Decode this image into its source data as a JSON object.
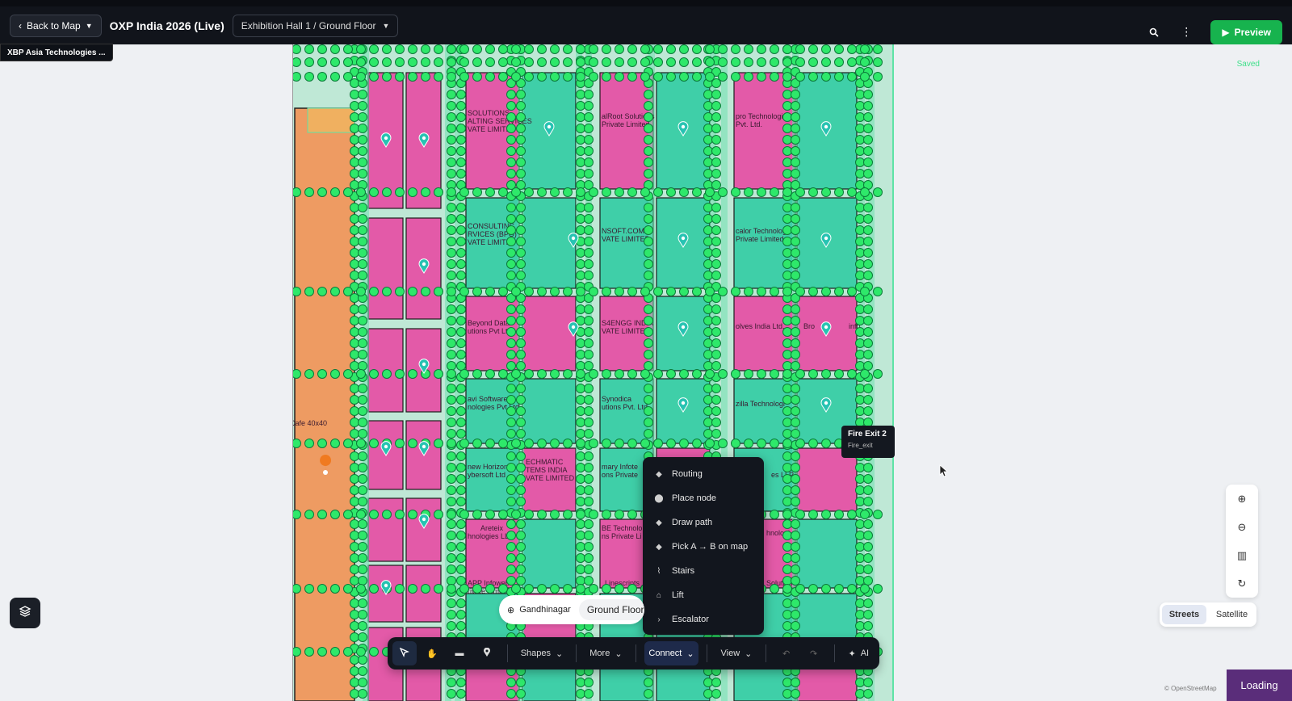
{
  "header": {
    "back_label": "Back to Map",
    "event_title": "OXP India 2026 (Live)",
    "floor_path": "Exhibition Hall 1 / Ground Floor",
    "preview_label": "Preview"
  },
  "selection_label": "XBP Asia Technologies ...",
  "save_status": "Saved",
  "booths": [
    "SOLUTIONS",
    "ALTING SERVICES",
    "VATE LIMITED",
    "alRoot Solutions",
    "Private Limited",
    "pro Technologies",
    "Pvt. Ltd.",
    "CONSULTING",
    "RVICES (BPO)",
    "VATE LIMITED",
    "NSOFT.COM",
    "VATE LIMITED",
    "calor Technologies",
    "Private Limited",
    "Beyond Data",
    "utions Pvt Ltd",
    "S4ENGG INDIA",
    "VATE LIMITED",
    "olves India Ltd.",
    "Bro",
    "info",
    "avi Software",
    "nologies Pvt Ltd",
    "Synodica",
    "utions Pvt. Ltd.",
    "zilla Technologi",
    "new Horizons",
    "ybersoft Ltd",
    "ECHMATIC",
    "TEMS INDIA",
    "VATE LIMITED",
    "mary Infote",
    "ons Private",
    "es LLP",
    "Areteix",
    "hnologies LLP",
    "BE Technolo",
    "ns Private Li",
    "hnologi",
    "APP Infoweb",
    "rivate Limit",
    "Linescripts",
    "Solution",
    "Cafe 40x40"
  ],
  "tooltip": {
    "title": "Fire Exit 2",
    "subtitle": "Fire_exit"
  },
  "connect_menu": [
    {
      "label": "Routing",
      "icon": "diamond-icon"
    },
    {
      "label": "Place node",
      "icon": "pin-icon"
    },
    {
      "label": "Draw path",
      "icon": "diamond-icon"
    },
    {
      "label": "Pick A → B on map",
      "icon": "diamond-icon"
    },
    {
      "label": "Stairs",
      "icon": "stairs-icon"
    },
    {
      "label": "Lift",
      "icon": "lift-icon"
    },
    {
      "label": "Escalator",
      "icon": "chevron-right-icon"
    }
  ],
  "location": {
    "city": "Gandhinagar",
    "floor": "Ground Floor"
  },
  "toolbar": {
    "shapes_label": "Shapes",
    "more_label": "More",
    "connect_label": "Connect",
    "view_label": "View",
    "ai_label": "AI"
  },
  "map_style": {
    "streets_label": "Streets",
    "satellite_label": "Satellite",
    "active": "Streets"
  },
  "attribution": "© OpenStreetMap",
  "loading_label": "Loading",
  "colors": {
    "booth_pink": "#e35aa8",
    "booth_teal": "#3fcfa8",
    "node_green": "#2ee86a",
    "cafe_orange": "#ee9b62",
    "preview_green": "#17b34e"
  }
}
